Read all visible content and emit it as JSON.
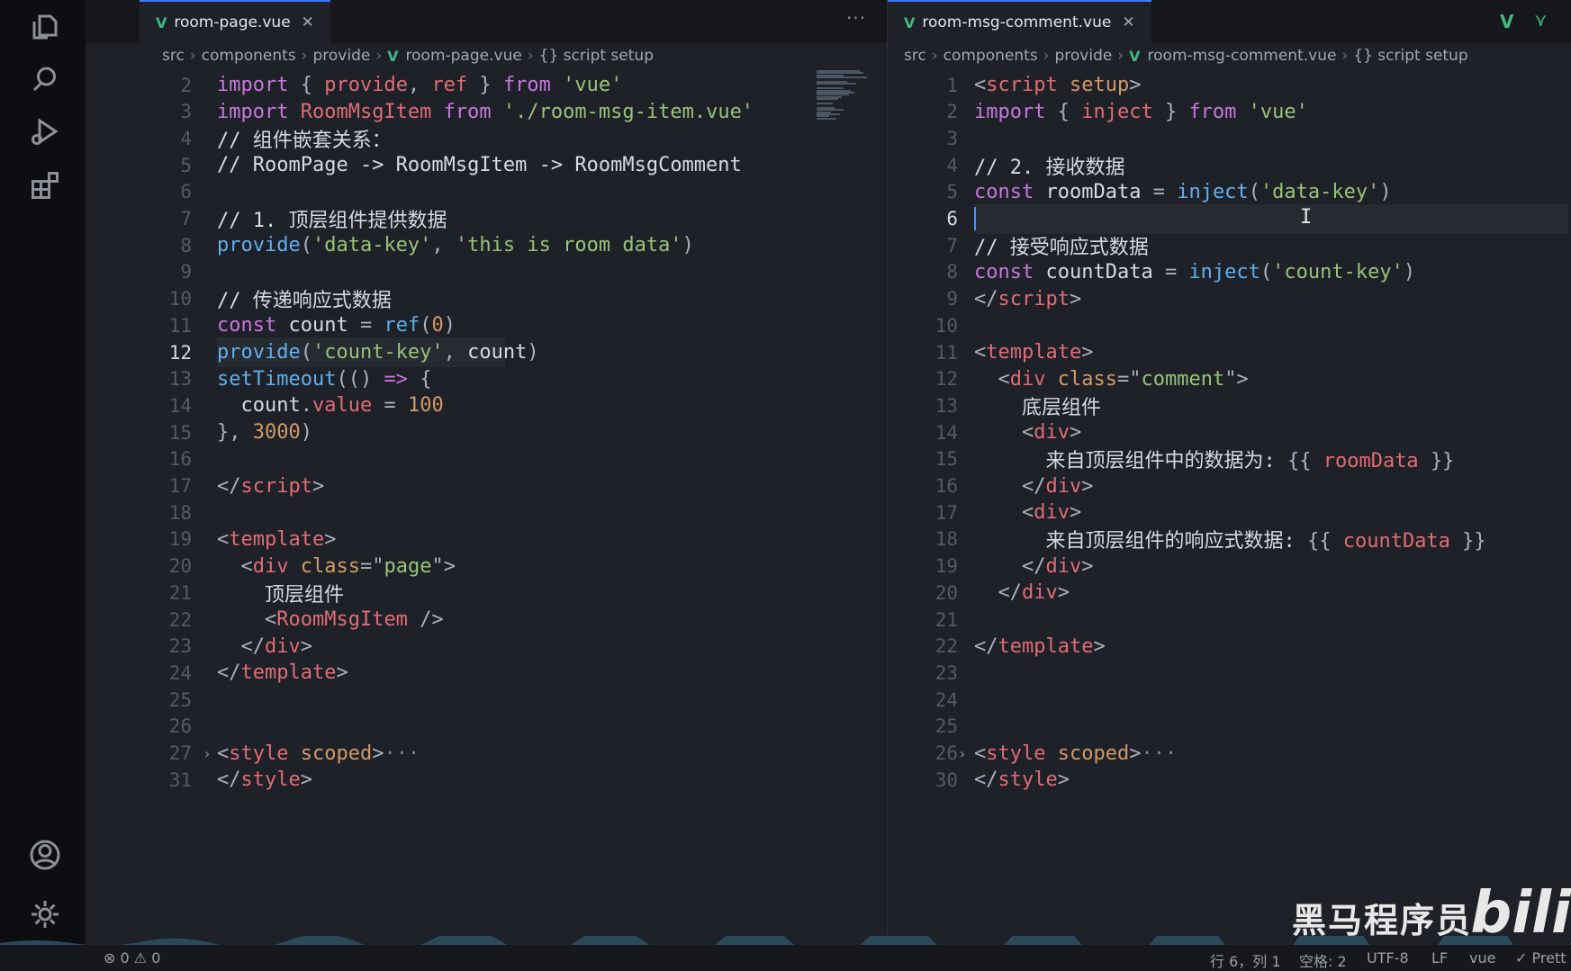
{
  "left": {
    "tab_title": "room-page.vue",
    "tab_close": "✕",
    "more": "···",
    "breadcrumb": [
      "src",
      "components",
      "provide",
      "room-page.vue",
      "{} script setup"
    ]
  },
  "right": {
    "tab_title": "room-msg-comment.vue",
    "tab_close": "✕",
    "breadcrumb": [
      "src",
      "components",
      "provide",
      "room-msg-comment.vue",
      "{} script setup"
    ]
  },
  "left_code": [
    {
      "n": "2",
      "toks": [
        [
          "k",
          "import "
        ],
        [
          "p",
          "{ "
        ],
        [
          "v",
          "provide"
        ],
        [
          "p",
          ", "
        ],
        [
          "v",
          "ref"
        ],
        [
          "p",
          " } "
        ],
        [
          "k",
          "from "
        ],
        [
          "s",
          "'vue'"
        ]
      ]
    },
    {
      "n": "3",
      "toks": [
        [
          "k",
          "import "
        ],
        [
          "v",
          "RoomMsgItem "
        ],
        [
          "k",
          "from "
        ],
        [
          "s",
          "'./room-msg-item.vue'"
        ]
      ]
    },
    {
      "n": "4",
      "toks": [
        [
          "w",
          "// 组件嵌套关系："
        ]
      ]
    },
    {
      "n": "5",
      "toks": [
        [
          "w",
          "// RoomPage -> RoomMsgItem -> RoomMsgComment"
        ]
      ]
    },
    {
      "n": "6",
      "toks": []
    },
    {
      "n": "7",
      "toks": [
        [
          "w",
          "// 1. 顶层组件提供数据"
        ]
      ]
    },
    {
      "n": "8",
      "toks": [
        [
          "f",
          "provide"
        ],
        [
          "p",
          "("
        ],
        [
          "s",
          "'data-key'"
        ],
        [
          "p",
          ", "
        ],
        [
          "s",
          "'this is room data'"
        ],
        [
          "p",
          ")"
        ]
      ]
    },
    {
      "n": "9",
      "toks": []
    },
    {
      "n": "10",
      "toks": [
        [
          "w",
          "// 传递响应式数据"
        ]
      ]
    },
    {
      "n": "11",
      "toks": [
        [
          "k",
          "const "
        ],
        [
          "w",
          "count "
        ],
        [
          "p",
          "= "
        ],
        [
          "f",
          "ref"
        ],
        [
          "p",
          "("
        ],
        [
          "n",
          "0"
        ],
        [
          "p",
          ")"
        ]
      ]
    },
    {
      "n": "12",
      "toks": [
        [
          "f",
          "provide"
        ],
        [
          "p",
          "("
        ],
        [
          "s",
          "'count-key'"
        ],
        [
          "p",
          ", "
        ],
        [
          "w",
          "count"
        ],
        [
          "p",
          ")"
        ]
      ]
    },
    {
      "n": "13",
      "toks": [
        [
          "f",
          "setTimeout"
        ],
        [
          "p",
          "(() "
        ],
        [
          "k",
          "=> "
        ],
        [
          "p",
          "{"
        ]
      ]
    },
    {
      "n": "14",
      "toks": [
        [
          "w",
          "  count"
        ],
        [
          "p",
          "."
        ],
        [
          "v",
          "value "
        ],
        [
          "p",
          "= "
        ],
        [
          "n",
          "100"
        ]
      ]
    },
    {
      "n": "15",
      "toks": [
        [
          "p",
          "}, "
        ],
        [
          "n",
          "3000"
        ],
        [
          "p",
          ")"
        ]
      ]
    },
    {
      "n": "16",
      "toks": []
    },
    {
      "n": "17",
      "toks": [
        [
          "p",
          "</"
        ],
        [
          "t",
          "script"
        ],
        [
          "p",
          ">"
        ]
      ]
    },
    {
      "n": "18",
      "toks": []
    },
    {
      "n": "19",
      "toks": [
        [
          "p",
          "<"
        ],
        [
          "t",
          "template"
        ],
        [
          "p",
          ">"
        ]
      ]
    },
    {
      "n": "20",
      "toks": [
        [
          "p",
          "  <"
        ],
        [
          "t",
          "div "
        ],
        [
          "a",
          "class"
        ],
        [
          "p",
          "=\""
        ],
        [
          "s",
          "page"
        ],
        [
          "p",
          "\">"
        ]
      ]
    },
    {
      "n": "21",
      "toks": [
        [
          "w",
          "    顶层组件"
        ]
      ]
    },
    {
      "n": "22",
      "toks": [
        [
          "p",
          "    <"
        ],
        [
          "v",
          "RoomMsgItem "
        ],
        [
          "p",
          "/>"
        ]
      ]
    },
    {
      "n": "23",
      "toks": [
        [
          "p",
          "  </"
        ],
        [
          "t",
          "div"
        ],
        [
          "p",
          ">"
        ]
      ]
    },
    {
      "n": "24",
      "toks": [
        [
          "p",
          "</"
        ],
        [
          "t",
          "template"
        ],
        [
          "p",
          ">"
        ]
      ]
    },
    {
      "n": "25",
      "toks": []
    },
    {
      "n": "26",
      "toks": []
    },
    {
      "n": "27",
      "toks": [
        [
          "p",
          "<"
        ],
        [
          "t",
          "style "
        ],
        [
          "a",
          "scoped"
        ],
        [
          "p",
          ">"
        ],
        [
          "c",
          "···"
        ]
      ]
    },
    {
      "n": "31",
      "toks": [
        [
          "p",
          "</"
        ],
        [
          "t",
          "style"
        ],
        [
          "p",
          ">"
        ]
      ]
    }
  ],
  "right_code": [
    {
      "n": "1",
      "toks": [
        [
          "p",
          "<"
        ],
        [
          "t",
          "script "
        ],
        [
          "a",
          "setup"
        ],
        [
          "p",
          ">"
        ]
      ]
    },
    {
      "n": "2",
      "toks": [
        [
          "k",
          "import "
        ],
        [
          "p",
          "{ "
        ],
        [
          "v",
          "inject "
        ],
        [
          "p",
          "} "
        ],
        [
          "k",
          "from "
        ],
        [
          "s",
          "'vue'"
        ]
      ]
    },
    {
      "n": "3",
      "toks": []
    },
    {
      "n": "4",
      "toks": [
        [
          "w",
          "// 2. 接收数据"
        ]
      ]
    },
    {
      "n": "5",
      "toks": [
        [
          "k",
          "const "
        ],
        [
          "w",
          "roomData "
        ],
        [
          "p",
          "= "
        ],
        [
          "f",
          "inject"
        ],
        [
          "p",
          "("
        ],
        [
          "s",
          "'data-key'"
        ],
        [
          "p",
          ")"
        ]
      ]
    },
    {
      "n": "6",
      "toks": []
    },
    {
      "n": "7",
      "toks": [
        [
          "w",
          "// 接受响应式数据"
        ]
      ]
    },
    {
      "n": "8",
      "toks": [
        [
          "k",
          "const "
        ],
        [
          "w",
          "countData "
        ],
        [
          "p",
          "= "
        ],
        [
          "f",
          "inject"
        ],
        [
          "p",
          "("
        ],
        [
          "s",
          "'count-key'"
        ],
        [
          "p",
          ")"
        ]
      ]
    },
    {
      "n": "9",
      "toks": [
        [
          "p",
          "</"
        ],
        [
          "t",
          "script"
        ],
        [
          "p",
          ">"
        ]
      ]
    },
    {
      "n": "10",
      "toks": []
    },
    {
      "n": "11",
      "toks": [
        [
          "p",
          "<"
        ],
        [
          "t",
          "template"
        ],
        [
          "p",
          ">"
        ]
      ]
    },
    {
      "n": "12",
      "toks": [
        [
          "p",
          "  <"
        ],
        [
          "t",
          "div "
        ],
        [
          "a",
          "class"
        ],
        [
          "p",
          "=\""
        ],
        [
          "s",
          "comment"
        ],
        [
          "p",
          "\">"
        ]
      ]
    },
    {
      "n": "13",
      "toks": [
        [
          "w",
          "    底层组件"
        ]
      ]
    },
    {
      "n": "14",
      "toks": [
        [
          "p",
          "    <"
        ],
        [
          "t",
          "div"
        ],
        [
          "p",
          ">"
        ]
      ]
    },
    {
      "n": "15",
      "toks": [
        [
          "w",
          "      来自顶层组件中的数据为: "
        ],
        [
          "p",
          "{{ "
        ],
        [
          "v",
          "roomData "
        ],
        [
          "p",
          "}}"
        ]
      ]
    },
    {
      "n": "16",
      "toks": [
        [
          "p",
          "    </"
        ],
        [
          "t",
          "div"
        ],
        [
          "p",
          ">"
        ]
      ]
    },
    {
      "n": "17",
      "toks": [
        [
          "p",
          "    <"
        ],
        [
          "t",
          "div"
        ],
        [
          "p",
          ">"
        ]
      ]
    },
    {
      "n": "18",
      "toks": [
        [
          "w",
          "      来自顶层组件的响应式数据: "
        ],
        [
          "p",
          "{{ "
        ],
        [
          "v",
          "countData "
        ],
        [
          "p",
          "}}"
        ]
      ]
    },
    {
      "n": "19",
      "toks": [
        [
          "p",
          "    </"
        ],
        [
          "t",
          "div"
        ],
        [
          "p",
          ">"
        ]
      ]
    },
    {
      "n": "20",
      "toks": [
        [
          "p",
          "  </"
        ],
        [
          "t",
          "div"
        ],
        [
          "p",
          ">"
        ]
      ]
    },
    {
      "n": "21",
      "toks": []
    },
    {
      "n": "22",
      "toks": [
        [
          "p",
          "</"
        ],
        [
          "t",
          "template"
        ],
        [
          "p",
          ">"
        ]
      ]
    },
    {
      "n": "23",
      "toks": []
    },
    {
      "n": "24",
      "toks": []
    },
    {
      "n": "25",
      "toks": []
    },
    {
      "n": "26",
      "toks": [
        [
          "p",
          "<"
        ],
        [
          "t",
          "style "
        ],
        [
          "a",
          "scoped"
        ],
        [
          "p",
          ">"
        ],
        [
          "c",
          "···"
        ]
      ]
    },
    {
      "n": "30",
      "toks": [
        [
          "p",
          "</"
        ],
        [
          "t",
          "style"
        ],
        [
          "p",
          ">"
        ]
      ]
    }
  ],
  "status": {
    "problems": "⊗ 0 ⚠ 0",
    "position": "行 6，列 1",
    "spaces": "空格: 2",
    "encoding": "UTF-8",
    "eol": "LF",
    "language": "vue",
    "prettier": "✓ Prett"
  },
  "watermark": "黑马程序员",
  "bili": "bili"
}
